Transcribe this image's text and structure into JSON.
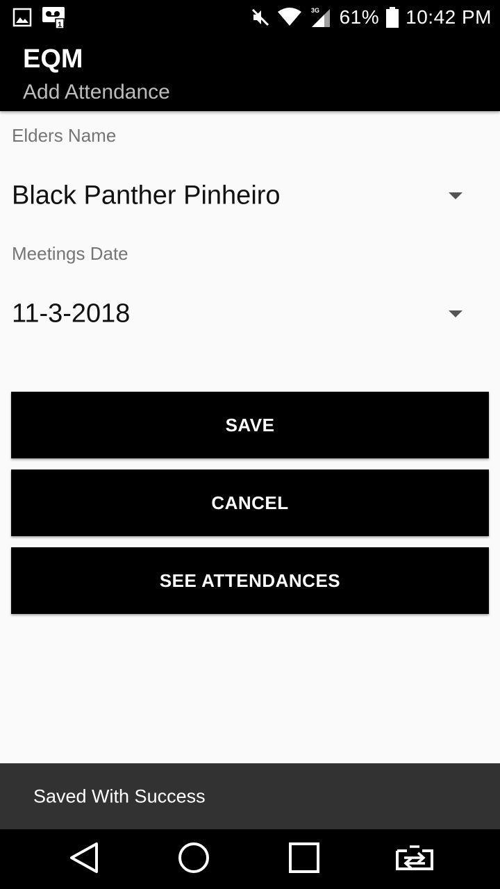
{
  "status_bar": {
    "battery": "61%",
    "time": "10:42 PM",
    "network": "3G",
    "icons": [
      "image-icon",
      "voicemail-icon",
      "mute-icon",
      "wifi-icon",
      "signal-icon",
      "battery-icon"
    ]
  },
  "app_bar": {
    "title": "EQM",
    "subtitle": "Add Attendance"
  },
  "form": {
    "elders_label": "Elders Name",
    "elders_value": "Black Panther Pinheiro",
    "date_label": "Meetings Date",
    "date_value": "11-3-2018"
  },
  "buttons": {
    "save": "SAVE",
    "cancel": "CANCEL",
    "see_attendances": "SEE ATTENDANCES"
  },
  "snackbar": {
    "message": "Saved With Success"
  },
  "nav_bar": {
    "icons": [
      "back-icon",
      "home-icon",
      "recents-icon",
      "rotate-icon"
    ]
  },
  "colors": {
    "primary": "#000000",
    "background": "#fafafa",
    "snackbar": "#323232",
    "label": "#757575"
  }
}
